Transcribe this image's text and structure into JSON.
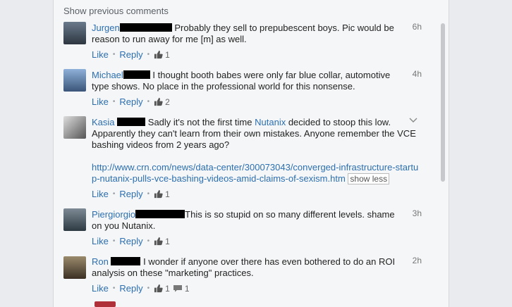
{
  "show_previous": "Show previous comments",
  "actions": {
    "like": "Like",
    "reply": "Reply",
    "dot": "•"
  },
  "comments": [
    {
      "name": "Jurgen",
      "text": "Probably they sell to prepubescent boys. Pic would be reason to run away for me [m] as well.",
      "time": "6h",
      "likes": "1"
    },
    {
      "name": "Michael",
      "text": "I thought booth babes were only far blue collar, automotive type shows. No place in the professional world for this nonsense.",
      "time": "4h",
      "likes": "2"
    },
    {
      "name": "Kasia",
      "text_a": "Sadly it's not the first time",
      "mention": "Nutanix",
      "text_b": "decided to stoop this low. Apparently they can't learn from their own mistakes. Anyone remember the VCE bashing videos from 2 years ago?",
      "url": "http://www.crn.com/news/data-center/300073043/converged-infrastructure-startup-nutanix-pulls-vce-bashing-videos-amid-claims-of-sexism.htm",
      "show_less": "show less",
      "likes": "1"
    },
    {
      "name": "Piergiorgio",
      "text": "This is so stupid on so many different levels. shame on you Nutanix.",
      "time": "3h",
      "likes": "1"
    },
    {
      "name": "Ron",
      "text": "I wonder if anyone over there has even bothered to do an ROI analysis on these \"marketing\" practices.",
      "time": "2h",
      "likes": "1",
      "replies": "1"
    }
  ]
}
